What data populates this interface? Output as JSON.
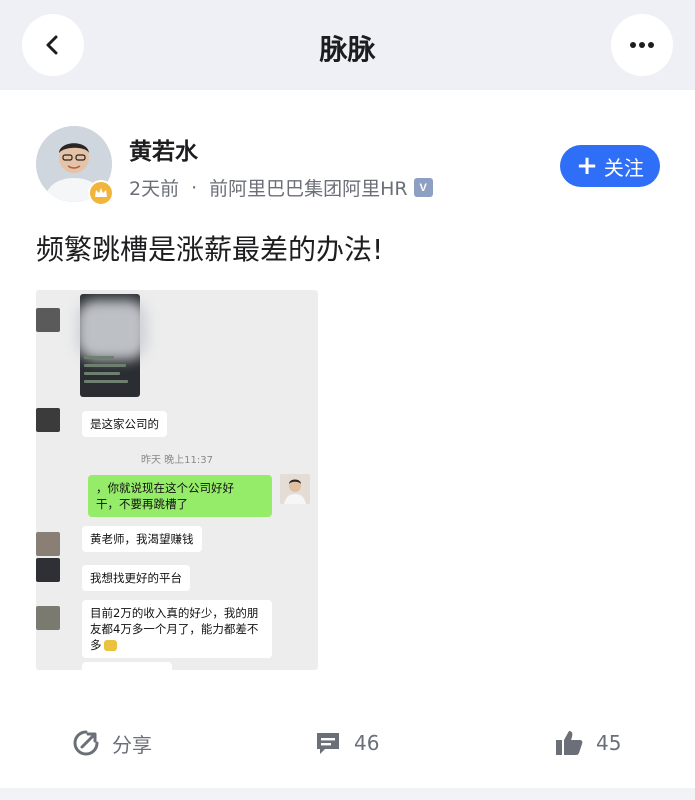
{
  "header": {
    "title": "脉脉",
    "back_icon": "chevron-left-icon",
    "more_icon": "ellipsis-icon"
  },
  "post": {
    "author": "黄若水",
    "time": "2天前",
    "separator": "·",
    "company": "前阿里巴巴集团阿里HR",
    "verified_badge": "V",
    "follow_label": "关注",
    "text": "频繁跳槽是涨薪最差的办法!",
    "follow_color": "#2f6ef6"
  },
  "chat_screenshot": {
    "msg_company": "是这家公司的",
    "timestamp": "昨天 晚上11:37",
    "msg_reply_line1": "，你就说现在这个公司好好",
    "msg_reply_line2": "干，不要再跳槽了",
    "msg_want_money": "黄老师，我渴望赚钱",
    "msg_platform": "我想找更好的平台",
    "msg_income_line1": "目前2万的收入真的好少，我的朋",
    "msg_income_line2": "友都4万多一个月了，能力都差不",
    "msg_income_line3": "多"
  },
  "actions": {
    "share_label": "分享",
    "comment_count": "46",
    "like_count": "45"
  }
}
